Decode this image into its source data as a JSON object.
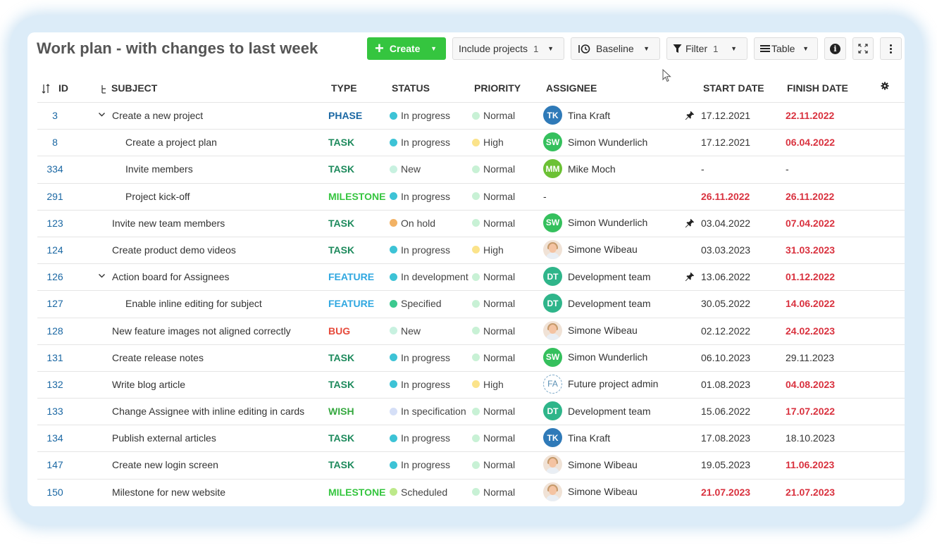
{
  "title": "Work plan - with changes to last week",
  "toolbar": {
    "create_label": "Create",
    "include_label": "Include projects",
    "include_count": "1",
    "baseline_label": "Baseline",
    "filter_label": "Filter",
    "filter_count": "1",
    "view_label": "Table"
  },
  "columns": {
    "id": "ID",
    "subject": "SUBJECT",
    "type": "TYPE",
    "status": "STATUS",
    "priority": "PRIORITY",
    "assignee": "ASSIGNEE",
    "start": "START DATE",
    "finish": "FINISH DATE"
  },
  "colors": {
    "accent_green": "#35c53f",
    "link_blue": "#1a67a3",
    "overdue_red": "#d9323f"
  },
  "rows": [
    {
      "id": "3",
      "subject": "Create a new project",
      "level": 1,
      "expandable": true,
      "type": "PHASE",
      "type_color": "#1a67a3",
      "status": "In progress",
      "status_color": "#3dc3d6",
      "priority": "Normal",
      "priority_color": "#c8f1d5",
      "assignee": "Tina Kraft",
      "initials": "TK",
      "avatar_color": "#2f7ab8",
      "avatar_kind": "initials",
      "pinned": true,
      "start": "17.12.2021",
      "start_overdue": false,
      "finish": "22.11.2022",
      "finish_overdue": true
    },
    {
      "id": "8",
      "subject": "Create a project plan",
      "level": 2,
      "expandable": false,
      "type": "TASK",
      "type_color": "#1d8a5c",
      "status": "In progress",
      "status_color": "#3dc3d6",
      "priority": "High",
      "priority_color": "#fbe38a",
      "assignee": "Simon Wunderlich",
      "initials": "SW",
      "avatar_color": "#35c05d",
      "avatar_kind": "initials",
      "pinned": false,
      "start": "17.12.2021",
      "start_overdue": false,
      "finish": "06.04.2022",
      "finish_overdue": true
    },
    {
      "id": "334",
      "subject": "Invite members",
      "level": 2,
      "expandable": false,
      "type": "TASK",
      "type_color": "#1d8a5c",
      "status": "New",
      "status_color": "#c8f1e0",
      "priority": "Normal",
      "priority_color": "#c8f1d5",
      "assignee": "Mike Moch",
      "initials": "MM",
      "avatar_color": "#6cc135",
      "avatar_kind": "initials",
      "pinned": false,
      "start": "-",
      "start_overdue": false,
      "finish": "-",
      "finish_overdue": false
    },
    {
      "id": "291",
      "subject": "Project kick-off",
      "level": 2,
      "expandable": false,
      "type": "MILESTONE",
      "type_color": "#35c53f",
      "status": "In progress",
      "status_color": "#3dc3d6",
      "priority": "Normal",
      "priority_color": "#c8f1d5",
      "assignee": "-",
      "initials": "",
      "avatar_color": "",
      "avatar_kind": "none",
      "pinned": false,
      "start": "26.11.2022",
      "start_overdue": true,
      "finish": "26.11.2022",
      "finish_overdue": true
    },
    {
      "id": "123",
      "subject": "Invite new team members",
      "level": 1,
      "expandable": false,
      "type": "TASK",
      "type_color": "#1d8a5c",
      "status": "On hold",
      "status_color": "#f2b264",
      "priority": "Normal",
      "priority_color": "#c8f1d5",
      "assignee": "Simon Wunderlich",
      "initials": "SW",
      "avatar_color": "#35c05d",
      "avatar_kind": "initials",
      "pinned": true,
      "start": "03.04.2022",
      "start_overdue": false,
      "finish": "07.04.2022",
      "finish_overdue": true
    },
    {
      "id": "124",
      "subject": "Create product demo videos",
      "level": 1,
      "expandable": false,
      "type": "TASK",
      "type_color": "#1d8a5c",
      "status": "In progress",
      "status_color": "#3dc3d6",
      "priority": "High",
      "priority_color": "#fbe38a",
      "assignee": "Simone Wibeau",
      "initials": "",
      "avatar_color": "",
      "avatar_kind": "photo",
      "pinned": false,
      "start": "03.03.2023",
      "start_overdue": false,
      "finish": "31.03.2023",
      "finish_overdue": true
    },
    {
      "id": "126",
      "subject": "Action board for Assignees",
      "level": 1,
      "expandable": true,
      "type": "FEATURE",
      "type_color": "#2fa7e0",
      "status": "In development",
      "status_color": "#3dc3d6",
      "priority": "Normal",
      "priority_color": "#c8f1d5",
      "assignee": "Development team",
      "initials": "DT",
      "avatar_color": "#2fb58a",
      "avatar_kind": "initials",
      "pinned": true,
      "start": "13.06.2022",
      "start_overdue": false,
      "finish": "01.12.2022",
      "finish_overdue": true
    },
    {
      "id": "127",
      "subject": "Enable inline editing for subject",
      "level": 2,
      "expandable": false,
      "type": "FEATURE",
      "type_color": "#2fa7e0",
      "status": "Specified",
      "status_color": "#3cc98f",
      "priority": "Normal",
      "priority_color": "#c8f1d5",
      "assignee": "Development team",
      "initials": "DT",
      "avatar_color": "#2fb58a",
      "avatar_kind": "initials",
      "pinned": false,
      "start": "30.05.2022",
      "start_overdue": false,
      "finish": "14.06.2022",
      "finish_overdue": true
    },
    {
      "id": "128",
      "subject": "New feature images not aligned correctly",
      "level": 1,
      "expandable": false,
      "type": "BUG",
      "type_color": "#e64a3b",
      "status": "New",
      "status_color": "#c8f1e0",
      "priority": "Normal",
      "priority_color": "#c8f1d5",
      "assignee": "Simone Wibeau",
      "initials": "",
      "avatar_color": "",
      "avatar_kind": "photo",
      "pinned": false,
      "start": "02.12.2022",
      "start_overdue": false,
      "finish": "24.02.2023",
      "finish_overdue": true
    },
    {
      "id": "131",
      "subject": "Create release notes",
      "level": 1,
      "expandable": false,
      "type": "TASK",
      "type_color": "#1d8a5c",
      "status": "In progress",
      "status_color": "#3dc3d6",
      "priority": "Normal",
      "priority_color": "#c8f1d5",
      "assignee": "Simon Wunderlich",
      "initials": "SW",
      "avatar_color": "#35c05d",
      "avatar_kind": "initials",
      "pinned": false,
      "start": "06.10.2023",
      "start_overdue": false,
      "finish": "29.11.2023",
      "finish_overdue": false
    },
    {
      "id": "132",
      "subject": "Write blog article",
      "level": 1,
      "expandable": false,
      "type": "TASK",
      "type_color": "#1d8a5c",
      "status": "In progress",
      "status_color": "#3dc3d6",
      "priority": "High",
      "priority_color": "#fbe38a",
      "assignee": "Future project admin",
      "initials": "FA",
      "avatar_color": "#ffffff",
      "avatar_kind": "outline",
      "pinned": false,
      "start": "01.08.2023",
      "start_overdue": false,
      "finish": "04.08.2023",
      "finish_overdue": true
    },
    {
      "id": "133",
      "subject": "Change Assignee with inline editing in cards",
      "level": 1,
      "expandable": false,
      "type": "WISH",
      "type_color": "#35a83f",
      "status": "In specification",
      "status_color": "#d5dff7",
      "priority": "Normal",
      "priority_color": "#c8f1d5",
      "assignee": "Development team",
      "initials": "DT",
      "avatar_color": "#2fb58a",
      "avatar_kind": "initials",
      "pinned": false,
      "start": "15.06.2022",
      "start_overdue": false,
      "finish": "17.07.2022",
      "finish_overdue": true
    },
    {
      "id": "134",
      "subject": "Publish external articles",
      "level": 1,
      "expandable": false,
      "type": "TASK",
      "type_color": "#1d8a5c",
      "status": "In progress",
      "status_color": "#3dc3d6",
      "priority": "Normal",
      "priority_color": "#c8f1d5",
      "assignee": "Tina Kraft",
      "initials": "TK",
      "avatar_color": "#2f7ab8",
      "avatar_kind": "initials",
      "pinned": false,
      "start": "17.08.2023",
      "start_overdue": false,
      "finish": "18.10.2023",
      "finish_overdue": false
    },
    {
      "id": "147",
      "subject": "Create new login screen",
      "level": 1,
      "expandable": false,
      "type": "TASK",
      "type_color": "#1d8a5c",
      "status": "In progress",
      "status_color": "#3dc3d6",
      "priority": "Normal",
      "priority_color": "#c8f1d5",
      "assignee": "Simone Wibeau",
      "initials": "",
      "avatar_color": "",
      "avatar_kind": "photo",
      "pinned": false,
      "start": "19.05.2023",
      "start_overdue": false,
      "finish": "11.06.2023",
      "finish_overdue": true
    },
    {
      "id": "150",
      "subject": "Milestone for new website",
      "level": 1,
      "expandable": false,
      "type": "MILESTONE",
      "type_color": "#35c53f",
      "status": "Scheduled",
      "status_color": "#bde98a",
      "priority": "Normal",
      "priority_color": "#c8f1d5",
      "assignee": "Simone Wibeau",
      "initials": "",
      "avatar_color": "",
      "avatar_kind": "photo",
      "pinned": false,
      "start": "21.07.2023",
      "start_overdue": true,
      "finish": "21.07.2023",
      "finish_overdue": true
    }
  ]
}
